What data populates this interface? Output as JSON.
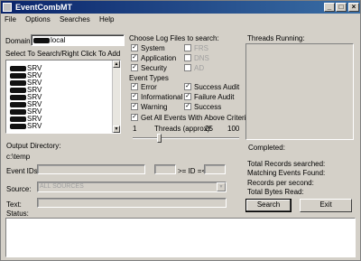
{
  "window": {
    "title": "EventCombMT"
  },
  "menu": [
    "File",
    "Options",
    "Searches",
    "Help"
  ],
  "domain": {
    "label": "Domain:",
    "value": "local"
  },
  "search_list": {
    "label": "Select To Search/Right Click To Add",
    "items": [
      "SRV",
      "SRV",
      "SRV",
      "SRV",
      "SRV",
      "SRV",
      "SRV",
      "SRV",
      "SRV"
    ]
  },
  "log_files": {
    "label": "Choose Log Files to search:",
    "options": [
      {
        "label": "System",
        "checked": true,
        "enabled": true
      },
      {
        "label": "FRS",
        "checked": false,
        "enabled": false
      },
      {
        "label": "Application",
        "checked": true,
        "enabled": true
      },
      {
        "label": "DNS",
        "checked": false,
        "enabled": false
      },
      {
        "label": "Security",
        "checked": true,
        "enabled": true
      },
      {
        "label": "AD",
        "checked": false,
        "enabled": false
      }
    ]
  },
  "event_types": {
    "label": "Event Types",
    "options": [
      {
        "label": "Error",
        "checked": true
      },
      {
        "label": "Success Audit",
        "checked": true
      },
      {
        "label": "Informational",
        "checked": true
      },
      {
        "label": "Failure Audit",
        "checked": true
      },
      {
        "label": "Warning",
        "checked": true
      },
      {
        "label": "Success",
        "checked": true
      }
    ],
    "get_all": {
      "label": "Get All Events With Above Criteria",
      "checked": true
    }
  },
  "threads": {
    "min": "1",
    "label": "Threads (approx):",
    "value": "25",
    "max": "100",
    "fraction": 0.24
  },
  "threads_running": {
    "label": "Threads Running:"
  },
  "status": {
    "completed": "Completed:",
    "total_records": "Total Records searched:",
    "matching_events": "Matching Events Found:",
    "records_per_second": "Records per second:",
    "total_bytes": "Total Bytes Read:"
  },
  "output": {
    "label": "Output Directory:",
    "value": "c:\\temp"
  },
  "event_ids": {
    "label": "Event IDs:",
    "range_label": ">= ID =<"
  },
  "source": {
    "label": "Source:",
    "value": "ALL SOURCES"
  },
  "text": {
    "label": "Text:"
  },
  "status_label": "Status:",
  "buttons": {
    "search": "Search",
    "exit": "Exit"
  },
  "colors": {
    "title_start": "#0a246a",
    "title_end": "#3a6ea5",
    "face": "#d4d0c8"
  }
}
